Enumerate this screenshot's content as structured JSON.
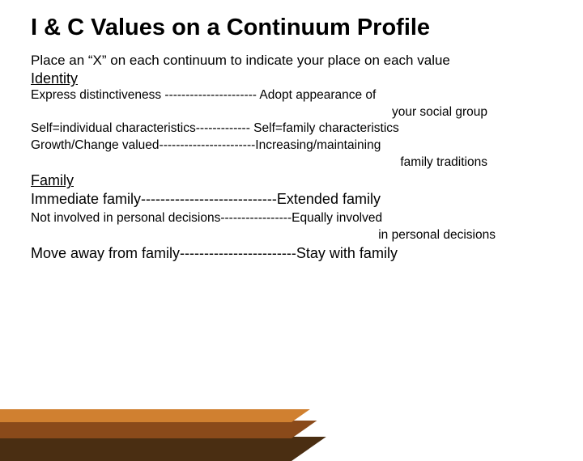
{
  "title": "I & C Values on a Continuum Profile",
  "instruction": "Place an “X” on each continuum to indicate your place on each value",
  "sections": {
    "identity": {
      "header": "Identity",
      "items": [
        {
          "left": "Express distinctiveness ",
          "dashes": "----------------------",
          "right": " Adopt appearance of",
          "sub": "your social group"
        },
        {
          "left": "Self=individual characteristics",
          "dashes": "-------------",
          "right": " Self=family characteristics",
          "sub": ""
        },
        {
          "left": "Growth/Change valued",
          "dashes": "-----------------------",
          "right": "Increasing/maintaining",
          "sub": "family traditions"
        }
      ]
    },
    "family": {
      "header": "Family",
      "items": [
        {
          "left": "Immediate family",
          "dashes": "----------------------------",
          "right": "Extended family",
          "sub": "",
          "size": "lg"
        },
        {
          "left": "Not involved in personal decisions",
          "dashes": "-----------------",
          "right": "Equally involved",
          "sub": "in personal decisions",
          "size": "sm"
        },
        {
          "left": "Move away from family",
          "dashes": "------------------------",
          "right": "Stay with family",
          "sub": "",
          "size": "lg"
        }
      ]
    }
  },
  "accent_colors": {
    "dark": "#4a2e12",
    "mid": "#8a4a1a",
    "light": "#d08030"
  }
}
